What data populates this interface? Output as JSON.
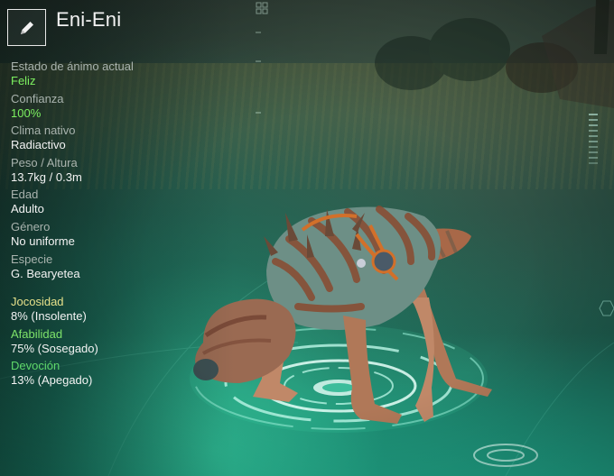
{
  "pet": {
    "name": "Eni-Eni"
  },
  "edit_button": {
    "icon": "pencil-icon"
  },
  "stats": [
    {
      "label": "Estado de ánimo actual",
      "value": "Feliz",
      "value_color": "#7cf060"
    },
    {
      "label": "Confianza",
      "value": "100%",
      "value_color": "#7cf060"
    },
    {
      "label": "Clima nativo",
      "value": "Radiactivo",
      "value_color": "#f3f3f3"
    },
    {
      "label": "Peso / Altura",
      "value": "13.7kg / 0.3m",
      "value_color": "#f3f3f3"
    },
    {
      "label": "Edad",
      "value": "Adulto",
      "value_color": "#f3f3f3"
    },
    {
      "label": "Género",
      "value": "No uniforme",
      "value_color": "#f3f3f3"
    },
    {
      "label": "Especie",
      "value": "G. Bearyetea",
      "value_color": "#f3f3f3"
    }
  ],
  "traits": [
    {
      "label": "Jocosidad",
      "value": "8% (Insolente)",
      "label_color": "#e6e08a"
    },
    {
      "label": "Afabilidad",
      "value": "75% (Sosegado)",
      "label_color": "#7ee36a"
    },
    {
      "label": "Devoción",
      "value": "13% (Apegado)",
      "label_color": "#5fd86a"
    }
  ]
}
